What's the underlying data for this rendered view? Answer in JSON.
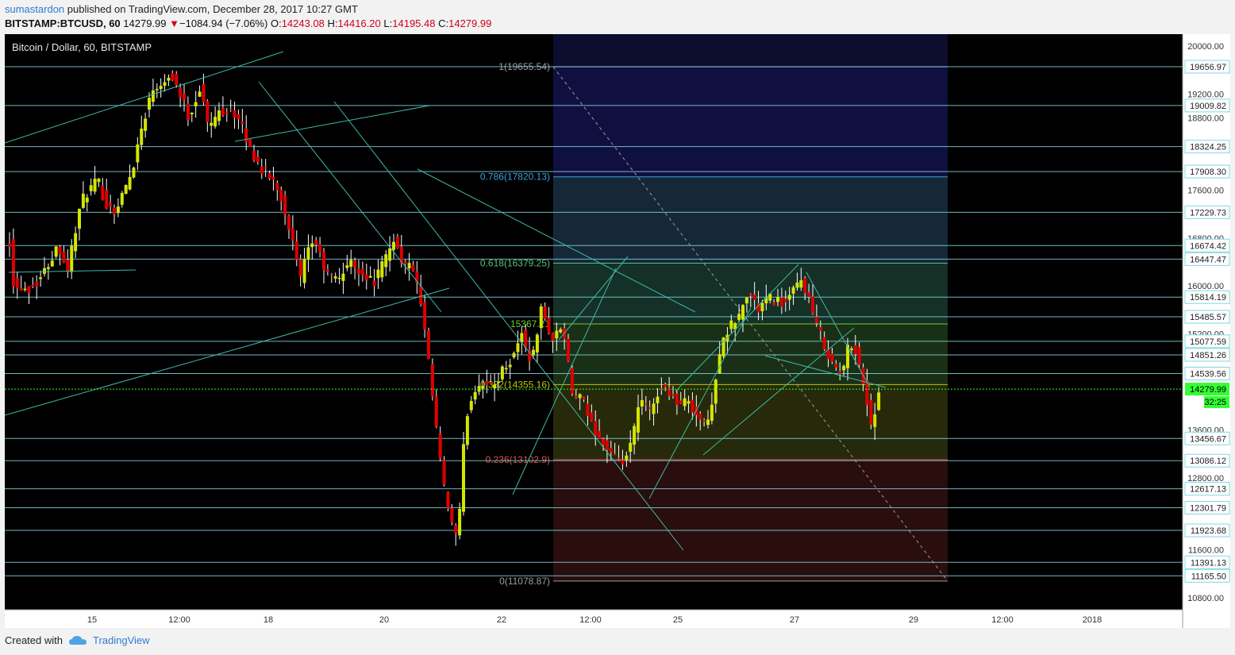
{
  "header": {
    "user": "sumastardon",
    "published": " published on TradingView.com, December 28, 2017 10:27 GMT",
    "symbol": "BITSTAMP:BTCUSD, 60",
    "last": "14279.99",
    "change_arrow": "▼",
    "change": "−1084.94 (−7.06%)",
    "o_label": "O:",
    "o": "14243.08",
    "h_label": "H:",
    "h": "14416.20",
    "l_label": "L:",
    "l": "14195.48",
    "c_label": "C:",
    "c": "14279.99"
  },
  "footer": {
    "created_with": "Created with",
    "brand": "TradingView"
  },
  "colors": {
    "background": "#000000",
    "up": "#d4e600",
    "down": "#e00000",
    "wick": "#ffffff",
    "horizontal": "#80d8e0",
    "trend": "#3fb8a8",
    "price_tag_bg": "#ffffff",
    "last_price_bg": "#33ff33",
    "last_price_line": "#33ff33"
  },
  "chart_data": {
    "type": "candlestick",
    "title": "Bitcoin / Dollar, 60, BITSTAMP",
    "ylim": [
      10600,
      20200
    ],
    "y_ticks": [
      "20000.00",
      "19200.00",
      "18800.00",
      "17600.00",
      "16800.00",
      "16000.00",
      "15200.00",
      "13600.00",
      "12800.00",
      "11600.00",
      "10800.00"
    ],
    "x_ticks": [
      "15",
      "12:00",
      "18",
      "20",
      "22",
      "12:00",
      "25",
      "27",
      "29",
      "12:00",
      "2018"
    ],
    "price_lines": [
      "19656.97",
      "19009.82",
      "18324.25",
      "17908.30",
      "17229.73",
      "16674.42",
      "16447.47",
      "15814.19",
      "15485.57",
      "15077.59",
      "14851.26",
      "14539.56",
      "13456.67",
      "13086.12",
      "12617.13",
      "12301.79",
      "11923.68",
      "11391.13",
      "11165.50"
    ],
    "last_price": "14279.99",
    "countdown": "32:25",
    "fib_levels": [
      {
        "level": 1,
        "label": "1(19655.54)",
        "price": 19655.54,
        "color": "#9e9e9e"
      },
      {
        "level": 0.786,
        "label": "0.786(17820.13)",
        "price": 17820.13,
        "color": "#3aa0e0"
      },
      {
        "level": 0.618,
        "label": "0.618(16379.25)",
        "price": 16379.25,
        "color": "#55c080"
      },
      {
        "level": 0.5,
        "label": "15367.21",
        "price": 15367.21,
        "color": "#6ccc30"
      },
      {
        "level": 0.382,
        "label": "0.382(14355.16)",
        "price": 14355.16,
        "color": "#b8c800"
      },
      {
        "level": 0.236,
        "label": "0.236(13102.9)",
        "price": 13102.9,
        "color": "#e05050"
      },
      {
        "level": 0,
        "label": "0(11078.87)",
        "price": 11078.87,
        "color": "#9e9e9e"
      }
    ],
    "anchors": [
      [
        0,
        16750
      ],
      [
        5,
        15900
      ],
      [
        10,
        16000
      ],
      [
        20,
        15950
      ],
      [
        30,
        16100
      ],
      [
        38,
        16300
      ],
      [
        50,
        16700
      ],
      [
        60,
        16250
      ],
      [
        66,
        16800
      ],
      [
        74,
        17400
      ],
      [
        82,
        17600
      ],
      [
        91,
        17750
      ],
      [
        100,
        17350
      ],
      [
        110,
        17250
      ],
      [
        118,
        17600
      ],
      [
        126,
        17900
      ],
      [
        134,
        18500
      ],
      [
        142,
        19000
      ],
      [
        148,
        19300
      ],
      [
        160,
        19450
      ],
      [
        168,
        19500
      ],
      [
        178,
        19100
      ],
      [
        185,
        18800
      ],
      [
        196,
        19300
      ],
      [
        206,
        18600
      ],
      [
        214,
        18900
      ],
      [
        228,
        18950
      ],
      [
        238,
        18700
      ],
      [
        250,
        18200
      ],
      [
        262,
        17900
      ],
      [
        275,
        17700
      ],
      [
        285,
        17200
      ],
      [
        292,
        16700
      ],
      [
        300,
        16100
      ],
      [
        306,
        16500
      ],
      [
        314,
        16800
      ],
      [
        326,
        16200
      ],
      [
        338,
        16100
      ],
      [
        350,
        16400
      ],
      [
        362,
        16250
      ],
      [
        375,
        16050
      ],
      [
        386,
        16400
      ],
      [
        396,
        16800
      ],
      [
        406,
        16350
      ],
      [
        416,
        16300
      ],
      [
        425,
        15600
      ],
      [
        432,
        14700
      ],
      [
        440,
        13600
      ],
      [
        448,
        12600
      ],
      [
        455,
        12100
      ],
      [
        462,
        11700
      ],
      [
        470,
        13800
      ],
      [
        480,
        14300
      ],
      [
        488,
        14400
      ],
      [
        498,
        14300
      ],
      [
        508,
        14600
      ],
      [
        518,
        14800
      ],
      [
        528,
        15200
      ],
      [
        538,
        14700
      ],
      [
        548,
        15600
      ],
      [
        560,
        15100
      ],
      [
        570,
        15350
      ],
      [
        580,
        14200
      ],
      [
        590,
        14100
      ],
      [
        600,
        13700
      ],
      [
        610,
        13400
      ],
      [
        620,
        13200
      ],
      [
        630,
        13000
      ],
      [
        640,
        13300
      ],
      [
        650,
        14100
      ],
      [
        660,
        13900
      ],
      [
        670,
        14300
      ],
      [
        680,
        14250
      ],
      [
        690,
        14000
      ],
      [
        700,
        14100
      ],
      [
        710,
        13800
      ],
      [
        720,
        13700
      ],
      [
        732,
        14900
      ],
      [
        742,
        15300
      ],
      [
        752,
        15500
      ],
      [
        762,
        15900
      ],
      [
        772,
        15600
      ],
      [
        782,
        15800
      ],
      [
        792,
        15750
      ],
      [
        800,
        15700
      ],
      [
        808,
        15900
      ],
      [
        815,
        16100
      ],
      [
        822,
        15900
      ],
      [
        830,
        15400
      ],
      [
        838,
        15100
      ],
      [
        848,
        14700
      ],
      [
        858,
        14500
      ],
      [
        866,
        15100
      ],
      [
        874,
        14850
      ],
      [
        882,
        14200
      ],
      [
        888,
        13700
      ],
      [
        898,
        14250
      ]
    ]
  }
}
